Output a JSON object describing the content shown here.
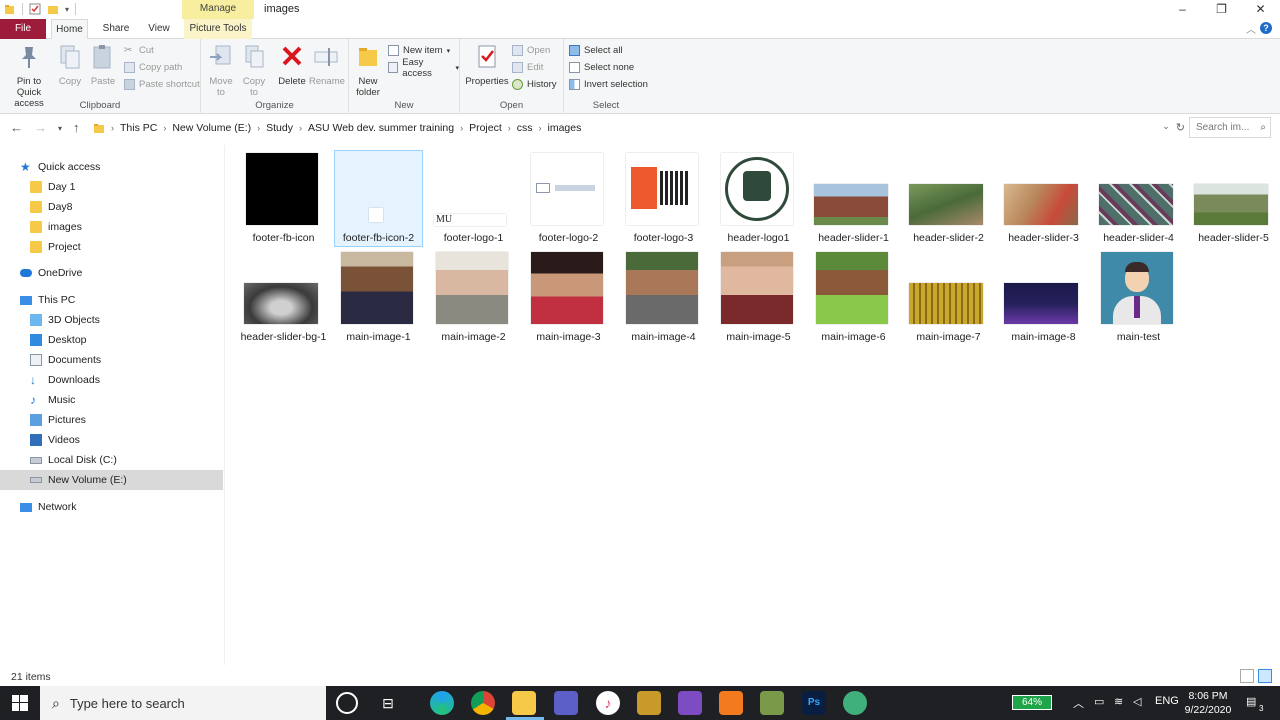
{
  "window": {
    "title": "images",
    "context_tab": "Manage",
    "controls": [
      "–",
      "❐",
      "✕"
    ]
  },
  "ribbon_tabs": {
    "file": "File",
    "home": "Home",
    "share": "Share",
    "view": "View",
    "picture_tools": "Picture Tools",
    "help": "?"
  },
  "ribbon": {
    "clipboard": {
      "label": "Clipboard",
      "pin": "Pin to Quick access",
      "copy": "Copy",
      "paste": "Paste",
      "cut": "Cut",
      "copy_path": "Copy path",
      "paste_shortcut": "Paste shortcut"
    },
    "organize": {
      "label": "Organize",
      "move_to": "Move to",
      "copy_to": "Copy to",
      "delete": "Delete",
      "rename": "Rename"
    },
    "new": {
      "label": "New",
      "new_folder": "New folder",
      "new_item": "New item",
      "easy_access": "Easy access"
    },
    "open": {
      "label": "Open",
      "properties": "Properties",
      "open": "Open",
      "edit": "Edit",
      "history": "History"
    },
    "select": {
      "label": "Select",
      "select_all": "Select all",
      "select_none": "Select none",
      "invert_selection": "Invert selection"
    }
  },
  "address": {
    "crumbs": [
      "This PC",
      "New Volume (E:)",
      "Study",
      "ASU Web dev. summer training",
      "Project",
      "css",
      "images"
    ],
    "search_placeholder": "Search im..."
  },
  "nav": {
    "quick_access": "Quick access",
    "quick_items": [
      "Day 1",
      "Day8",
      "images",
      "Project"
    ],
    "onedrive": "OneDrive",
    "this_pc": "This PC",
    "pc_items": [
      "3D Objects",
      "Desktop",
      "Documents",
      "Downloads",
      "Music",
      "Pictures",
      "Videos",
      "Local Disk (C:)",
      "New Volume (E:)"
    ],
    "network": "Network"
  },
  "files": [
    {
      "name": "footer-fb-icon",
      "color": "#000000"
    },
    {
      "name": "footer-fb-icon-2",
      "color": "#ffffff"
    },
    {
      "name": "footer-logo-1",
      "color": "#ffffff",
      "logo_text": "MU"
    },
    {
      "name": "footer-logo-2",
      "color": "#ffffff"
    },
    {
      "name": "footer-logo-3",
      "color": "#ee5a2c"
    },
    {
      "name": "header-logo1",
      "color": "#2f4a3a"
    },
    {
      "name": "header-slider-1",
      "color": "#8a4b3a"
    },
    {
      "name": "header-slider-2",
      "color": "#5d7a4b"
    },
    {
      "name": "header-slider-3",
      "color": "#b8865a"
    },
    {
      "name": "header-slider-4",
      "color": "#4f6f6a"
    },
    {
      "name": "header-slider-5",
      "color": "#7a8a5a"
    },
    {
      "name": "header-slider-bg-1",
      "color": "#5a5a5a"
    },
    {
      "name": "main-image-1",
      "color": "#3a3a52"
    },
    {
      "name": "main-image-2",
      "color": "#8a8a80"
    },
    {
      "name": "main-image-3",
      "color": "#c03040"
    },
    {
      "name": "main-image-4",
      "color": "#4a6a3a"
    },
    {
      "name": "main-image-5",
      "color": "#a8685a"
    },
    {
      "name": "main-image-6",
      "color": "#6a9a4a"
    },
    {
      "name": "main-image-7",
      "color": "#c9a82c"
    },
    {
      "name": "main-image-8",
      "color": "#26205a"
    },
    {
      "name": "main-test",
      "color": "#3f8aa8"
    }
  ],
  "status": {
    "item_count": "21 items"
  },
  "taskbar": {
    "search_placeholder": "Type here to search",
    "battery": "64%",
    "language": "ENG",
    "time": "8:06 PM",
    "date": "9/22/2020",
    "notification_count": "3"
  }
}
